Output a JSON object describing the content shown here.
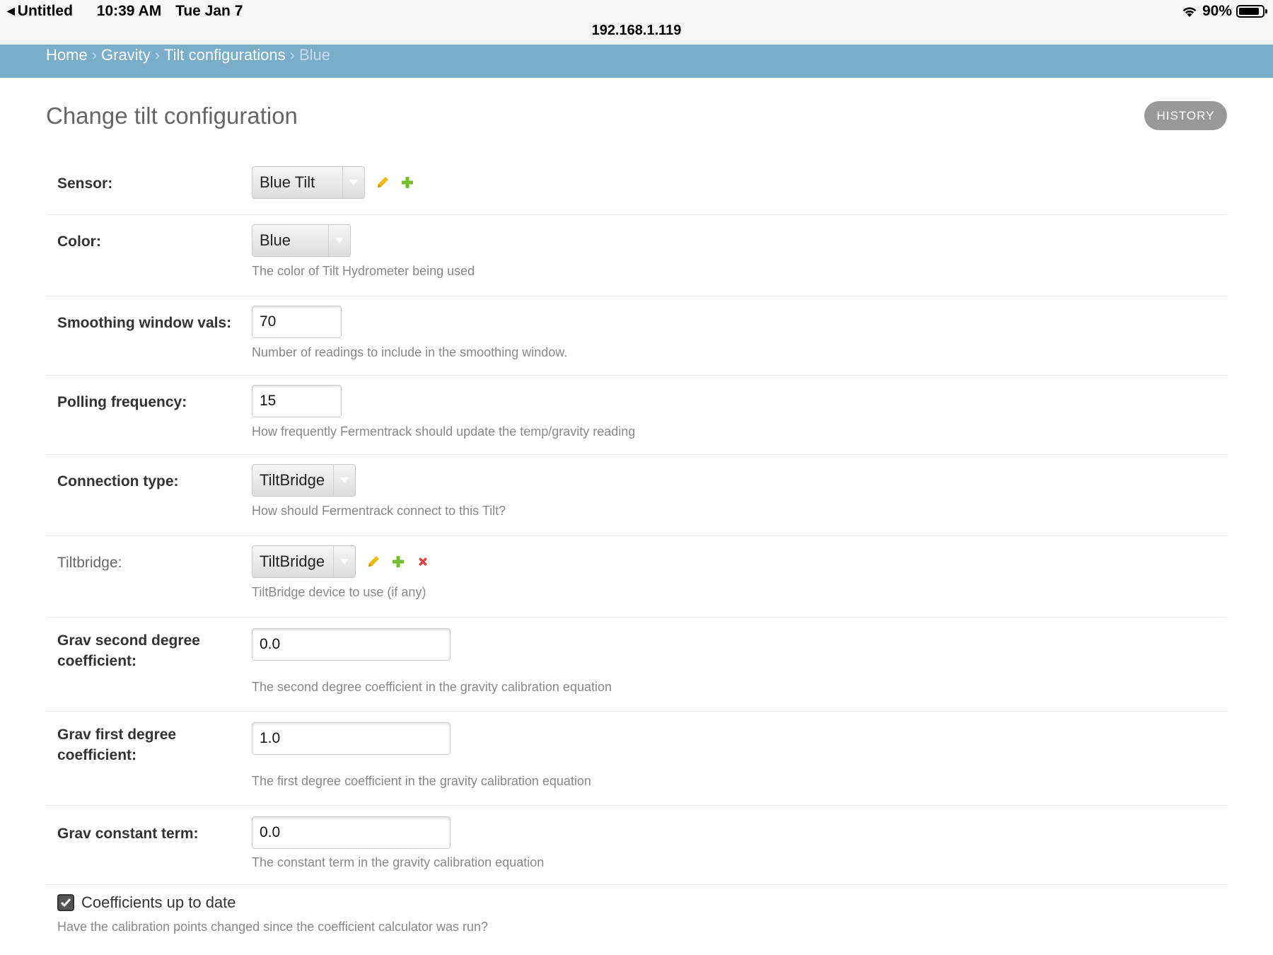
{
  "status_bar": {
    "back_label": "Untitled",
    "time": "10:39 AM",
    "date": "Tue Jan 7",
    "url": "192.168.1.119",
    "battery": "90%"
  },
  "breadcrumbs": {
    "home": "Home",
    "gravity": "Gravity",
    "tilt_configurations": "Tilt configurations",
    "current": "Blue",
    "separator": "›"
  },
  "page": {
    "title": "Change tilt configuration",
    "history_label": "HISTORY"
  },
  "fields": {
    "sensor": {
      "label": "Sensor:",
      "value": "Blue Tilt"
    },
    "color": {
      "label": "Color:",
      "value": "Blue",
      "help": "The color of Tilt Hydrometer being used"
    },
    "smoothing": {
      "label": "Smoothing window vals:",
      "value": "70",
      "help": "Number of readings to include in the smoothing window."
    },
    "polling": {
      "label": "Polling frequency:",
      "value": "15",
      "help": "How frequently Fermentrack should update the temp/gravity reading"
    },
    "connection": {
      "label": "Connection type:",
      "value": "TiltBridge",
      "help": "How should Fermentrack connect to this Tilt?"
    },
    "tiltbridge": {
      "label": "Tiltbridge:",
      "value": "TiltBridge",
      "help": "TiltBridge device to use (if any)"
    },
    "grav_second": {
      "label_line1": "Grav second degree",
      "label_line2": "coefficient:",
      "value": "0.0",
      "help": "The second degree coefficient in the gravity calibration equation"
    },
    "grav_first": {
      "label_line1": "Grav first degree",
      "label_line2": "coefficient:",
      "value": "1.0",
      "help": "The first degree coefficient in the gravity calibration equation"
    },
    "grav_constant": {
      "label": "Grav constant term:",
      "value": "0.0",
      "help": "The constant term in the gravity calibration equation"
    },
    "coefficients": {
      "label": "Coefficients up to date",
      "checked": true,
      "help": "Have the calibration points changed since the coefficient calculator was run?"
    }
  },
  "colors": {
    "breadcrumb_bg": "#79aec8",
    "history_bg": "#999999",
    "edit_icon": "#efb80b",
    "add_icon": "#70bf2b",
    "delete_icon": "#dd4646"
  }
}
